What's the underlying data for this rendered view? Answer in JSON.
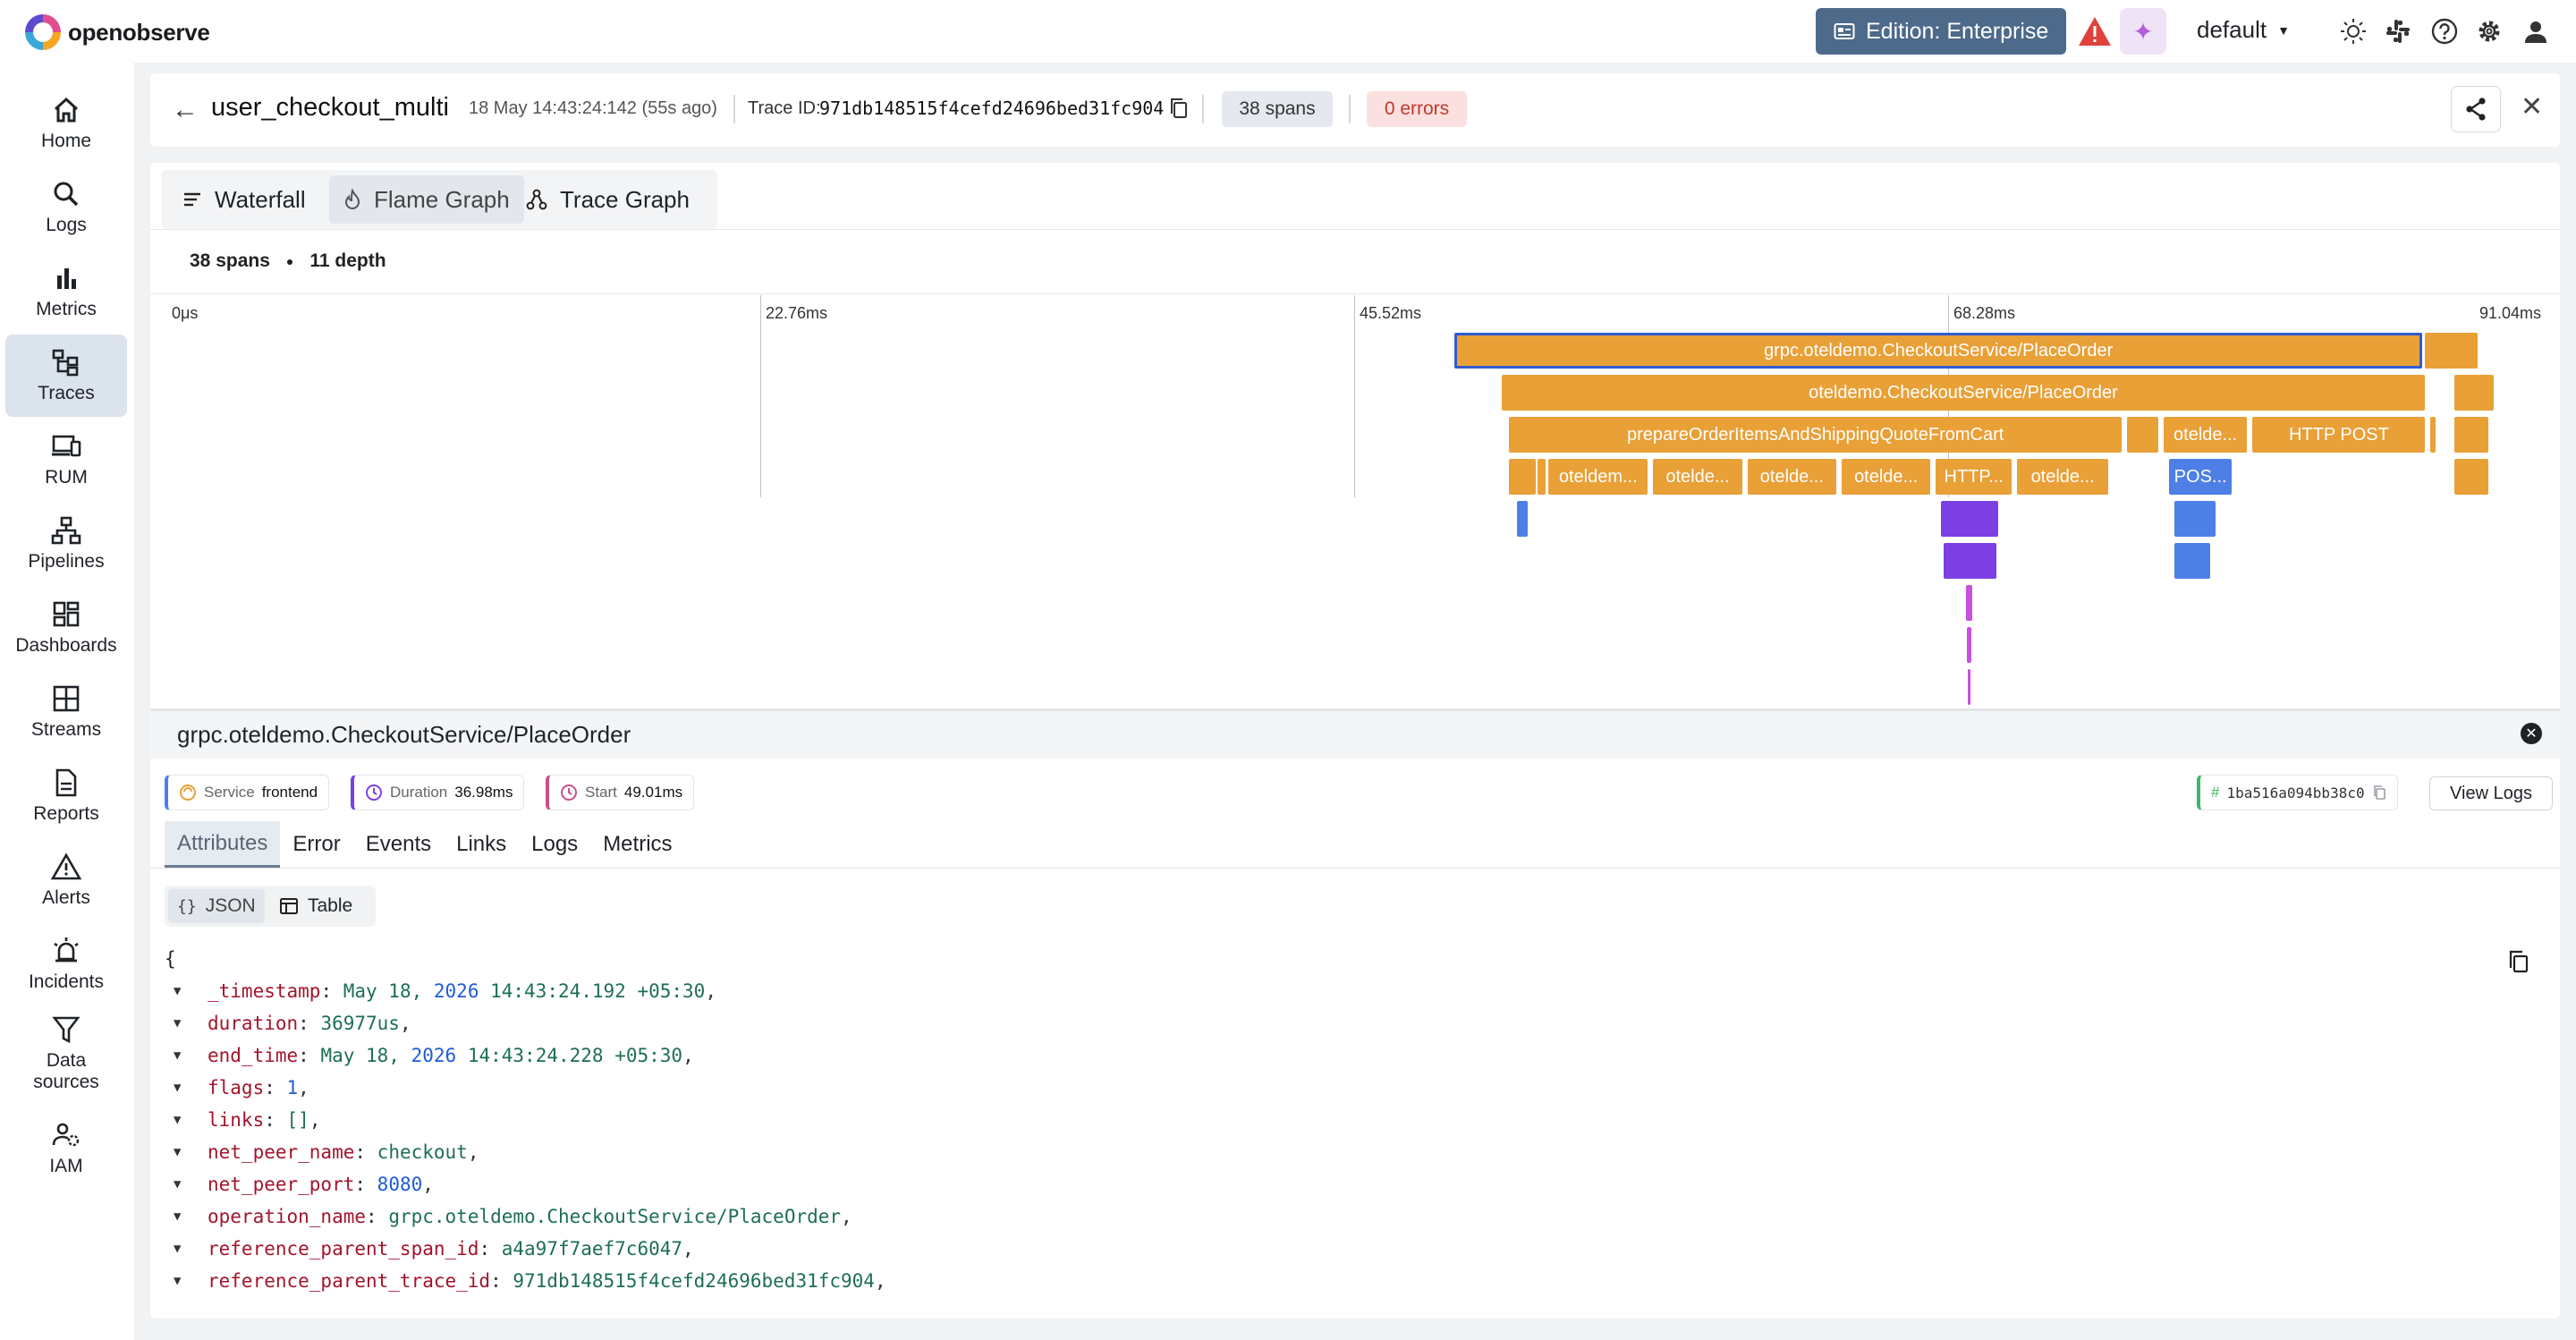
{
  "app": {
    "logo_text": "openobserve"
  },
  "topbar": {
    "edition": "Edition: Enterprise",
    "org": "default",
    "icons": [
      "warning-icon",
      "ai-assistant-icon",
      "theme-icon",
      "slack-icon",
      "help-icon",
      "settings-icon",
      "user-icon"
    ]
  },
  "sidebar": {
    "items": [
      {
        "label": "Home",
        "icon": "home-icon",
        "active": false
      },
      {
        "label": "Logs",
        "icon": "search-icon",
        "active": false
      },
      {
        "label": "Metrics",
        "icon": "bar-chart-icon",
        "active": false
      },
      {
        "label": "Traces",
        "icon": "traces-icon",
        "active": true
      },
      {
        "label": "RUM",
        "icon": "devices-icon",
        "active": false
      },
      {
        "label": "Pipelines",
        "icon": "pipelines-icon",
        "active": false
      },
      {
        "label": "Dashboards",
        "icon": "dashboards-icon",
        "active": false
      },
      {
        "label": "Streams",
        "icon": "streams-icon",
        "active": false
      },
      {
        "label": "Reports",
        "icon": "reports-icon",
        "active": false
      },
      {
        "label": "Alerts",
        "icon": "alert-icon",
        "active": false
      },
      {
        "label": "Incidents",
        "icon": "incidents-icon",
        "active": false
      },
      {
        "label": "Data sources",
        "icon": "filter-icon",
        "active": false
      },
      {
        "label": "IAM",
        "icon": "iam-icon",
        "active": false
      }
    ]
  },
  "trace": {
    "name": "user_checkout_multi",
    "time": "18 May 14:43:24:142 (55s ago)",
    "id_label": "Trace ID:",
    "id": "971db148515f4cefd24696bed31fc904",
    "spans_badge": "38 spans",
    "errors_badge": "0 errors"
  },
  "view_tabs": [
    {
      "label": "Waterfall",
      "icon": "list-icon",
      "active": false
    },
    {
      "label": "Flame Graph",
      "icon": "flame-icon",
      "active": true
    },
    {
      "label": "Trace Graph",
      "icon": "graph-icon",
      "active": false
    }
  ],
  "stats": {
    "spans": "38 spans",
    "depth": "11 depth"
  },
  "timeline": {
    "ticks": [
      "0μs",
      "22.76ms",
      "45.52ms",
      "68.28ms",
      "91.04ms"
    ],
    "total_ms": 91.04
  },
  "flame": {
    "colors": {
      "frontend": "#e9a037",
      "blue": "#4d7fe6",
      "purple": "#7c3fe4",
      "magenta": "#c94fe0"
    },
    "spans": [
      {
        "label": "grpc.oteldemo.CheckoutService/PlaceOrder",
        "depth": 0,
        "start_ms": 49.01,
        "dur_ms": 36.98,
        "color": "frontend",
        "selected": true
      },
      {
        "label": "",
        "depth": 0,
        "start_ms": 86.1,
        "dur_ms": 2.0,
        "color": "frontend"
      },
      {
        "label": "oteldemo.CheckoutService/PlaceOrder",
        "depth": 1,
        "start_ms": 50.8,
        "dur_ms": 35.3,
        "color": "frontend"
      },
      {
        "label": "",
        "depth": 1,
        "start_ms": 87.2,
        "dur_ms": 1.5,
        "color": "frontend"
      },
      {
        "label": "prepareOrderItemsAndShippingQuoteFromCart",
        "depth": 2,
        "start_ms": 51.1,
        "dur_ms": 23.4,
        "color": "frontend"
      },
      {
        "label": "",
        "depth": 2,
        "start_ms": 74.7,
        "dur_ms": 1.2,
        "color": "frontend"
      },
      {
        "label": "otelde...",
        "depth": 2,
        "start_ms": 76.1,
        "dur_ms": 3.2,
        "color": "frontend"
      },
      {
        "label": "HTTP POST",
        "depth": 2,
        "start_ms": 79.5,
        "dur_ms": 6.6,
        "color": "frontend"
      },
      {
        "label": "",
        "depth": 2,
        "start_ms": 86.3,
        "dur_ms": 0.2,
        "color": "frontend"
      },
      {
        "label": "",
        "depth": 2,
        "start_ms": 87.2,
        "dur_ms": 1.3,
        "color": "frontend"
      },
      {
        "label": "",
        "depth": 3,
        "start_ms": 51.1,
        "dur_ms": 1.0,
        "color": "frontend"
      },
      {
        "label": "",
        "depth": 3,
        "start_ms": 52.2,
        "dur_ms": 0.3,
        "color": "frontend"
      },
      {
        "label": "oteldem...",
        "depth": 3,
        "start_ms": 52.6,
        "dur_ms": 3.8,
        "color": "frontend"
      },
      {
        "label": "otelde...",
        "depth": 3,
        "start_ms": 56.6,
        "dur_ms": 3.4,
        "color": "frontend"
      },
      {
        "label": "otelde...",
        "depth": 3,
        "start_ms": 60.2,
        "dur_ms": 3.4,
        "color": "frontend"
      },
      {
        "label": "otelde...",
        "depth": 3,
        "start_ms": 63.8,
        "dur_ms": 3.4,
        "color": "frontend"
      },
      {
        "label": "HTTP...",
        "depth": 3,
        "start_ms": 67.4,
        "dur_ms": 2.9,
        "color": "frontend"
      },
      {
        "label": "otelde...",
        "depth": 3,
        "start_ms": 70.5,
        "dur_ms": 3.5,
        "color": "frontend"
      },
      {
        "label": "POS...",
        "depth": 3,
        "start_ms": 76.3,
        "dur_ms": 2.4,
        "color": "blue"
      },
      {
        "label": "",
        "depth": 3,
        "start_ms": 87.2,
        "dur_ms": 1.3,
        "color": "frontend"
      },
      {
        "label": "",
        "depth": 4,
        "start_ms": 51.4,
        "dur_ms": 0.4,
        "color": "blue"
      },
      {
        "label": "",
        "depth": 4,
        "start_ms": 67.6,
        "dur_ms": 2.2,
        "color": "purple"
      },
      {
        "label": "",
        "depth": 4,
        "start_ms": 76.5,
        "dur_ms": 1.6,
        "color": "blue"
      },
      {
        "label": "",
        "depth": 5,
        "start_ms": 67.7,
        "dur_ms": 2.0,
        "color": "purple"
      },
      {
        "label": "",
        "depth": 5,
        "start_ms": 76.5,
        "dur_ms": 1.4,
        "color": "blue"
      },
      {
        "label": "",
        "depth": 6,
        "start_ms": 68.55,
        "dur_ms": 0.25,
        "color": "magenta"
      },
      {
        "label": "",
        "depth": 7,
        "start_ms": 68.6,
        "dur_ms": 0.15,
        "color": "magenta"
      },
      {
        "label": "",
        "depth": 8,
        "start_ms": 68.62,
        "dur_ms": 0.08,
        "color": "magenta"
      }
    ]
  },
  "span_detail": {
    "title": "grpc.oteldemo.CheckoutService/PlaceOrder",
    "service_label": "Service",
    "service": "frontend",
    "duration_label": "Duration",
    "duration": "36.98ms",
    "start_label": "Start",
    "start": "49.01ms",
    "span_id_prefix": "#",
    "span_id": "1ba516a094bb38c0",
    "view_logs": "View Logs",
    "tabs": [
      "Attributes",
      "Error",
      "Events",
      "Links",
      "Logs",
      "Metrics"
    ],
    "active_tab": "Attributes",
    "format_json": "JSON",
    "format_table": "Table",
    "json_open": "{",
    "attributes": [
      {
        "key": "_timestamp",
        "value": "May 18, ",
        "num": "2026",
        "rest": " 14:43:24.192 +05:30"
      },
      {
        "key": "duration",
        "value": "36977us"
      },
      {
        "key": "end_time",
        "value": "May 18, ",
        "num": "2026",
        "rest": " 14:43:24.228 +05:30"
      },
      {
        "key": "flags",
        "num": "1"
      },
      {
        "key": "links",
        "value": "[]"
      },
      {
        "key": "net_peer_name",
        "value": "checkout"
      },
      {
        "key": "net_peer_port",
        "num": "8080"
      },
      {
        "key": "operation_name",
        "value": "grpc.oteldemo.CheckoutService/PlaceOrder"
      },
      {
        "key": "reference_parent_span_id",
        "value": "a4a97f7aef7c6047"
      },
      {
        "key": "reference_parent_trace_id",
        "value": "971db148515f4cefd24696bed31fc904"
      }
    ]
  }
}
